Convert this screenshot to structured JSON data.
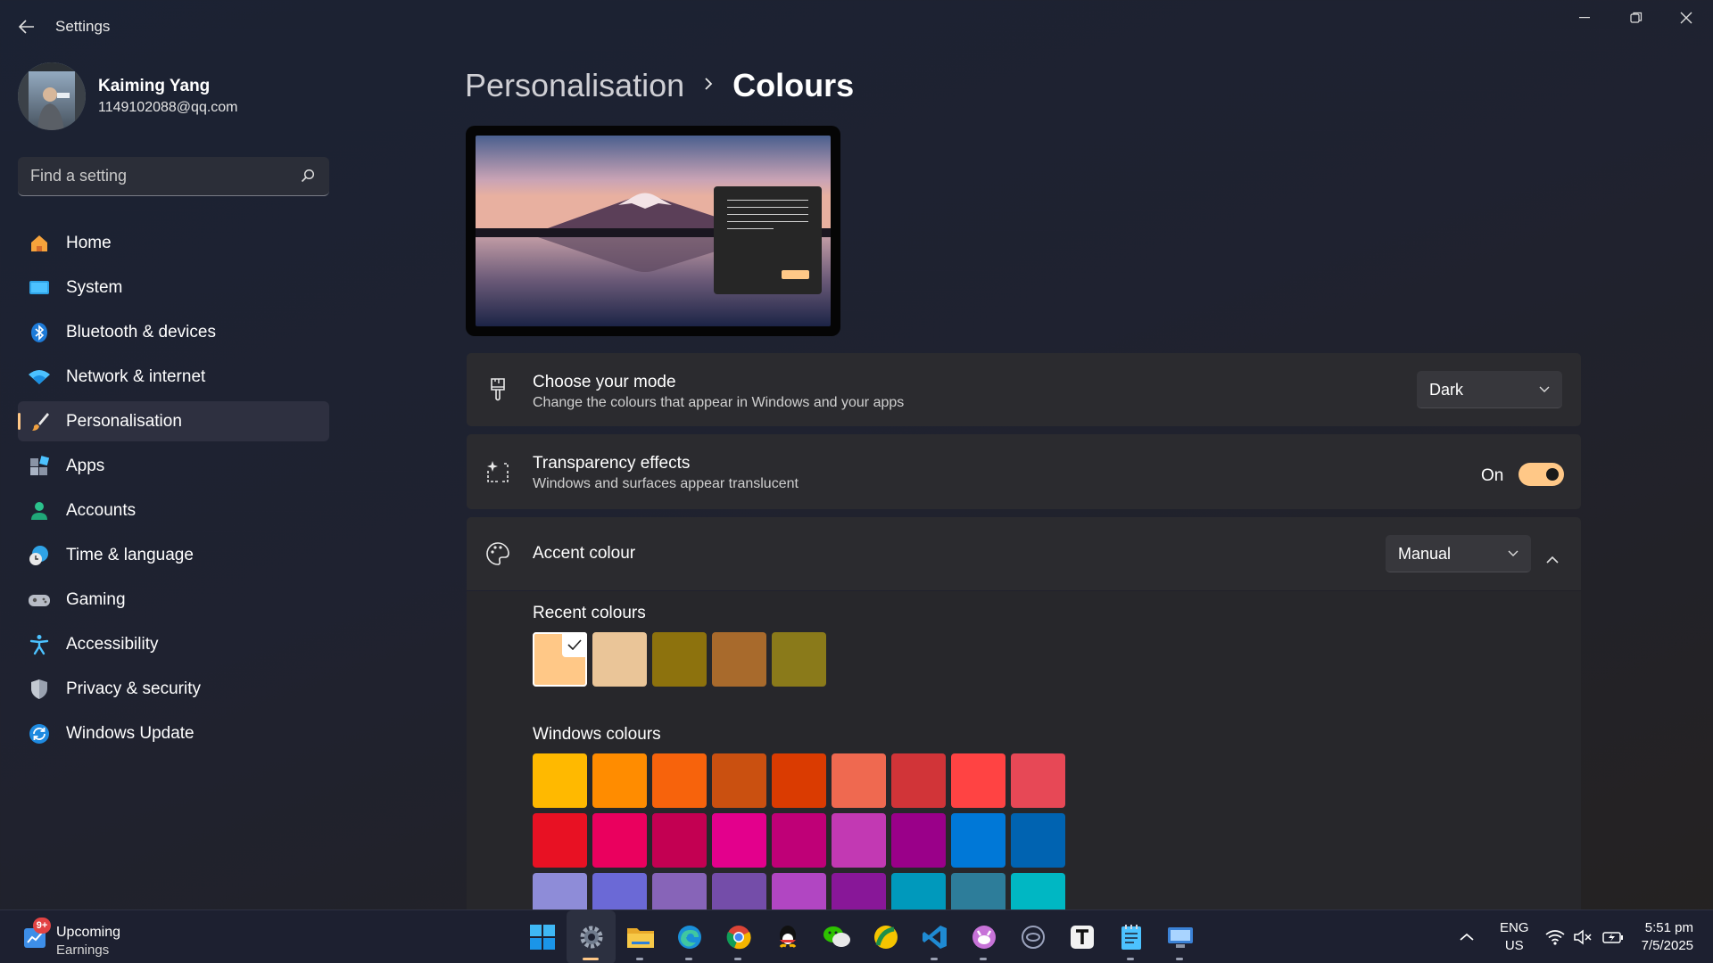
{
  "window": {
    "title": "Settings"
  },
  "profile": {
    "name": "Kaiming Yang",
    "email": "1149102088@qq.com"
  },
  "search": {
    "placeholder": "Find a setting"
  },
  "nav": [
    {
      "label": "Home",
      "icon": "home-icon",
      "active": false
    },
    {
      "label": "System",
      "icon": "system-icon",
      "active": false
    },
    {
      "label": "Bluetooth & devices",
      "icon": "bluetooth-icon",
      "active": false
    },
    {
      "label": "Network & internet",
      "icon": "wifi-icon",
      "active": false
    },
    {
      "label": "Personalisation",
      "icon": "brush-icon",
      "active": true
    },
    {
      "label": "Apps",
      "icon": "apps-icon",
      "active": false
    },
    {
      "label": "Accounts",
      "icon": "account-icon",
      "active": false
    },
    {
      "label": "Time & language",
      "icon": "time-language-icon",
      "active": false
    },
    {
      "label": "Gaming",
      "icon": "gamepad-icon",
      "active": false
    },
    {
      "label": "Accessibility",
      "icon": "accessibility-icon",
      "active": false
    },
    {
      "label": "Privacy & security",
      "icon": "shield-icon",
      "active": false
    },
    {
      "label": "Windows Update",
      "icon": "update-icon",
      "active": false
    }
  ],
  "breadcrumb": {
    "parent": "Personalisation",
    "current": "Colours"
  },
  "mode": {
    "title": "Choose your mode",
    "subtitle": "Change the colours that appear in Windows and your apps",
    "value": "Dark"
  },
  "transparency": {
    "title": "Transparency effects",
    "subtitle": "Windows and surfaces appear translucent",
    "state_label": "On",
    "enabled": true
  },
  "accent": {
    "title": "Accent colour",
    "value": "Manual",
    "expanded": true,
    "recent_label": "Recent colours",
    "recent_colors": [
      "#ffc887",
      "#eac598",
      "#8d720d",
      "#a86a2c",
      "#8a7a1a"
    ],
    "selected_color": "#ffc887",
    "windows_label": "Windows colours",
    "windows_colors": [
      [
        "#ffb900",
        "#ff8c00",
        "#f7630c",
        "#ca5010",
        "#da3b01",
        "#ef6950",
        "#d13438",
        "#ff4343",
        "#e74856"
      ],
      [
        "#e81123",
        "#ea005e",
        "#c30052",
        "#e3008c",
        "#bf0077",
        "#c239b3",
        "#9a0089",
        "#0078d7",
        "#0063b1"
      ],
      [
        "#8e8cd8",
        "#6b69d6",
        "#8764b8",
        "#744da9",
        "#b146c2",
        "#881798",
        "#0099bc",
        "#2d7d9a",
        "#00b7c3"
      ]
    ]
  },
  "colors": {
    "accent": "#ffc887",
    "card_bg": "#2b2b2f",
    "taskbar_bg": "#1d2030"
  },
  "taskbar": {
    "widget_title": "Upcoming",
    "widget_subtitle": "Earnings",
    "widget_badge": "9+",
    "apps": [
      {
        "name": "start-icon",
        "running": false,
        "active": false
      },
      {
        "name": "settings-icon",
        "running": true,
        "active": true
      },
      {
        "name": "file-explorer-icon",
        "running": true,
        "active": false
      },
      {
        "name": "edge-icon",
        "running": true,
        "active": false
      },
      {
        "name": "chrome-icon",
        "running": true,
        "active": false
      },
      {
        "name": "qq-icon",
        "running": false,
        "active": false
      },
      {
        "name": "wechat-icon",
        "running": false,
        "active": false
      },
      {
        "name": "linux-do-icon",
        "running": false,
        "active": false
      },
      {
        "name": "vscode-icon",
        "running": true,
        "active": false
      },
      {
        "name": "cat-app-icon",
        "running": true,
        "active": false
      },
      {
        "name": "eye-app-icon",
        "running": false,
        "active": false
      },
      {
        "name": "typora-icon",
        "running": false,
        "active": false
      },
      {
        "name": "notepad-icon",
        "running": true,
        "active": false
      },
      {
        "name": "remote-desktop-icon",
        "running": true,
        "active": false
      }
    ],
    "lang_top": "ENG",
    "lang_bottom": "US",
    "time": "5:51 pm",
    "date": "7/5/2025"
  }
}
